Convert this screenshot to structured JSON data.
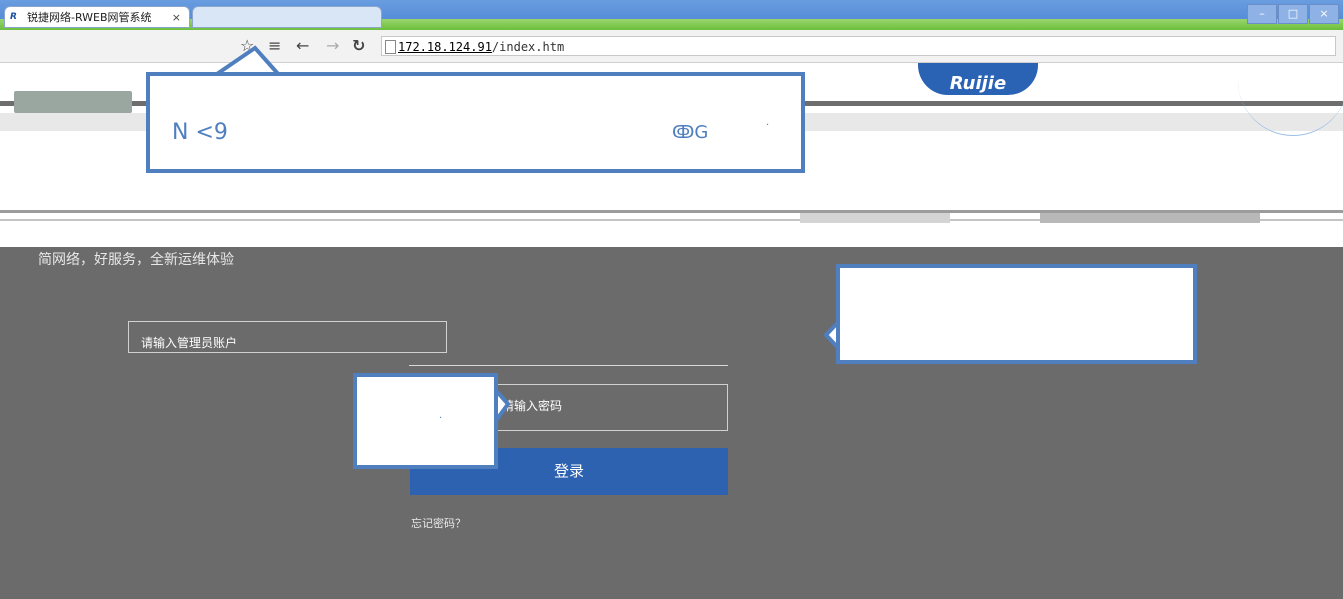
{
  "browser": {
    "active_tab_title": "锐捷网络-RWEB网管系统",
    "tab_close_glyph": "×",
    "favicon_text": "R",
    "url_host": "172.18.124.91",
    "url_path": "/index.htm",
    "window_controls": [
      "–",
      "□",
      "×"
    ],
    "toolbar_icons": [
      "star-icon",
      "menu-icon",
      "back-icon",
      "forward-icon",
      "reload-icon"
    ]
  },
  "header": {
    "brand_right": "Ruijie"
  },
  "login": {
    "slogan": "简网络，好服务，全新运维体验",
    "account_placeholder": "请输入管理员账户",
    "password_placeholder": "请输入密码",
    "login_label": "登录",
    "forgot_label": "忘记密码？"
  },
  "annotations": {
    "callout1_text": "N <9",
    "callout1_glyph": "ↂG",
    "dot": "·"
  },
  "colors": {
    "accent": "#2d62b0",
    "callout_border": "#4f7fbf",
    "dark_bg": "#6b6b6b"
  }
}
